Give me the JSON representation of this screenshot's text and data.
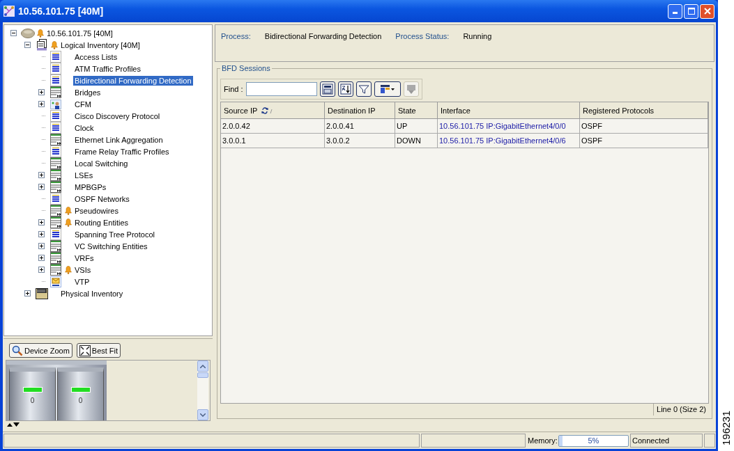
{
  "window": {
    "title": "10.56.101.75 [40M]"
  },
  "tree": [
    {
      "label": "10.56.101.75 [40M]",
      "kind": "device",
      "expanded": true,
      "alarm": true,
      "selected": false,
      "children": [
        {
          "label": "Logical Inventory [40M]",
          "kind": "inventory",
          "expanded": true,
          "alarm": true,
          "selected": false,
          "children": [
            {
              "label": "Access Lists",
              "kind": "table-blue",
              "alarm": false,
              "selected": false
            },
            {
              "label": "ATM Traffic Profiles",
              "kind": "table-blue",
              "alarm": false,
              "selected": false
            },
            {
              "label": "Bidirectional Forwarding Detection",
              "kind": "table-blue",
              "alarm": false,
              "selected": true
            },
            {
              "label": "Bridges",
              "kind": "table-green",
              "expanded": false,
              "alarm": false,
              "selected": false
            },
            {
              "label": "CFM",
              "kind": "cfm",
              "expanded": false,
              "alarm": false,
              "selected": false
            },
            {
              "label": "Cisco Discovery Protocol",
              "kind": "table-blue",
              "alarm": false,
              "selected": false
            },
            {
              "label": "Clock",
              "kind": "table-blue",
              "alarm": false,
              "selected": false
            },
            {
              "label": "Ethernet Link Aggregation",
              "kind": "table-green",
              "alarm": false,
              "selected": false
            },
            {
              "label": "Frame Relay Traffic Profiles",
              "kind": "table-blue",
              "alarm": false,
              "selected": false
            },
            {
              "label": "Local Switching",
              "kind": "table-green",
              "alarm": false,
              "selected": false
            },
            {
              "label": "LSEs",
              "kind": "table-green",
              "expanded": false,
              "alarm": false,
              "selected": false
            },
            {
              "label": "MPBGPs",
              "kind": "table-green",
              "expanded": false,
              "alarm": false,
              "selected": false
            },
            {
              "label": "OSPF Networks",
              "kind": "table-blue",
              "alarm": false,
              "selected": false
            },
            {
              "label": "Pseudowires",
              "kind": "table-green",
              "alarm": true,
              "selected": false
            },
            {
              "label": "Routing Entities",
              "kind": "table-green",
              "expanded": false,
              "alarm": true,
              "selected": false
            },
            {
              "label": "Spanning Tree Protocol",
              "kind": "table-blue",
              "expanded": false,
              "alarm": false,
              "selected": false
            },
            {
              "label": "VC Switching Entities",
              "kind": "table-green",
              "expanded": false,
              "alarm": false,
              "selected": false
            },
            {
              "label": "VRFs",
              "kind": "table-green",
              "expanded": false,
              "alarm": false,
              "selected": false
            },
            {
              "label": "VSIs",
              "kind": "table-green",
              "expanded": false,
              "alarm": true,
              "selected": false
            },
            {
              "label": "VTP",
              "kind": "vtp",
              "alarm": false,
              "selected": false
            }
          ]
        },
        {
          "label": "Physical Inventory",
          "kind": "chassis",
          "expanded": false,
          "alarm": false,
          "selected": false
        }
      ]
    }
  ],
  "device_view": {
    "buttons": [
      {
        "label": "Device Zoom",
        "kind": "zoom"
      },
      {
        "label": "Best Fit",
        "kind": "fit"
      }
    ],
    "slots": [
      {
        "label": "0"
      },
      {
        "label": "0"
      }
    ]
  },
  "process": {
    "label": "Process:",
    "value": "Bidirectional Forwarding Detection",
    "status_label": "Process Status:",
    "status_value": "Running"
  },
  "sessions": {
    "title": "BFD Sessions",
    "find_label": "Find :",
    "columns": [
      {
        "label": "Source IP",
        "sorted": true,
        "kind": "text"
      },
      {
        "label": "Destination IP",
        "sorted": false,
        "kind": "text"
      },
      {
        "label": "State",
        "sorted": false,
        "kind": "text"
      },
      {
        "label": "Interface",
        "sorted": false,
        "kind": "link"
      },
      {
        "label": "Registered Protocols",
        "sorted": false,
        "kind": "text"
      }
    ],
    "rows": [
      {
        "cells": [
          "2.0.0.42",
          "2.0.0.41",
          "UP",
          "10.56.101.75 IP:GigabitEthernet4/0/0",
          "OSPF"
        ]
      },
      {
        "cells": [
          "3.0.0.1",
          "3.0.0.2",
          "DOWN",
          "10.56.101.75 IP:GigabitEthernet4/0/6",
          "OSPF"
        ]
      }
    ],
    "footer": "Line 0 (Size 2)"
  },
  "status_bar": {
    "memory_label": "Memory:",
    "memory": {
      "level": 0.05,
      "reading": "5%"
    },
    "connection": "Connected"
  },
  "figure_id": "196231"
}
